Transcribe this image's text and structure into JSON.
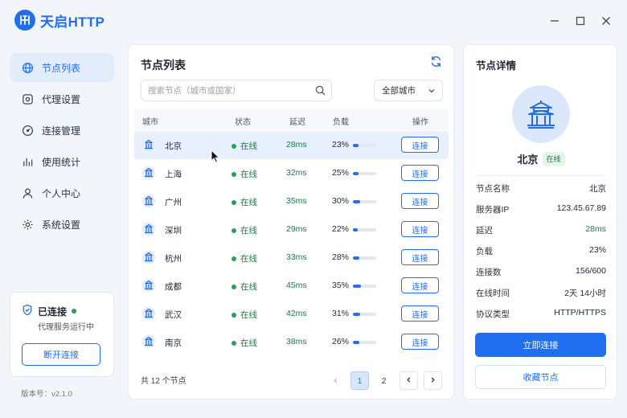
{
  "app": {
    "title": "天启HTTP",
    "accent": "#1f6ff0",
    "online_color": "#1e7a45"
  },
  "window_controls": {
    "minimize": "minimize-icon",
    "maximize": "maximize-icon",
    "close": "close-icon"
  },
  "sidebar": {
    "items": [
      {
        "label": "节点列表",
        "icon": "globe-icon",
        "active": true
      },
      {
        "label": "代理设置",
        "icon": "proxy-icon",
        "active": false
      },
      {
        "label": "连接管理",
        "icon": "gauge-icon",
        "active": false
      },
      {
        "label": "使用统计",
        "icon": "chart-icon",
        "active": false
      },
      {
        "label": "个人中心",
        "icon": "user-icon",
        "active": false
      },
      {
        "label": "系统设置",
        "icon": "gear-icon",
        "active": false
      }
    ],
    "status": {
      "title": "已连接",
      "subtitle": "代理服务运行中",
      "button": "断开连接"
    },
    "version": "版本号：v2.1.0"
  },
  "node_list": {
    "title": "节点列表",
    "search_placeholder": "搜索节点（城市或国家）",
    "filter": "全部城市",
    "columns": {
      "city": "城市",
      "status": "状态",
      "latency": "延迟",
      "load": "负载",
      "action": "操作"
    },
    "rows": [
      {
        "city": "北京",
        "status": "在线",
        "latency": "28ms",
        "load": "23%",
        "load_value": 0.23,
        "action": "连接",
        "selected": true
      },
      {
        "city": "上海",
        "status": "在线",
        "latency": "32ms",
        "load": "25%",
        "load_value": 0.25,
        "action": "连接",
        "selected": false
      },
      {
        "city": "广州",
        "status": "在线",
        "latency": "35ms",
        "load": "30%",
        "load_value": 0.3,
        "action": "连接",
        "selected": false
      },
      {
        "city": "深圳",
        "status": "在线",
        "latency": "29ms",
        "load": "22%",
        "load_value": 0.22,
        "action": "连接",
        "selected": false
      },
      {
        "city": "杭州",
        "status": "在线",
        "latency": "33ms",
        "load": "28%",
        "load_value": 0.28,
        "action": "连接",
        "selected": false
      },
      {
        "city": "成都",
        "status": "在线",
        "latency": "45ms",
        "load": "35%",
        "load_value": 0.35,
        "action": "连接",
        "selected": false
      },
      {
        "city": "武汉",
        "status": "在线",
        "latency": "42ms",
        "load": "31%",
        "load_value": 0.31,
        "action": "连接",
        "selected": false
      },
      {
        "city": "南京",
        "status": "在线",
        "latency": "38ms",
        "load": "26%",
        "load_value": 0.26,
        "action": "连接",
        "selected": false
      }
    ],
    "total": "共 12 个节点",
    "pagination": {
      "pages": [
        "1",
        "2"
      ],
      "current": "1"
    }
  },
  "detail": {
    "title": "节点详情",
    "name": "北京",
    "badge": "在线",
    "fields": [
      {
        "label": "节点名称",
        "value": "北京"
      },
      {
        "label": "服务器IP",
        "value": "123.45.67.89"
      },
      {
        "label": "延迟",
        "value": "28ms"
      },
      {
        "label": "负载",
        "value": "23%"
      },
      {
        "label": "连接数",
        "value": "156/600"
      },
      {
        "label": "在线时间",
        "value": "2天 14小时"
      },
      {
        "label": "协议类型",
        "value": "HTTP/HTTPS"
      }
    ],
    "connect_button": "立即连接",
    "favorite_button": "收藏节点"
  }
}
